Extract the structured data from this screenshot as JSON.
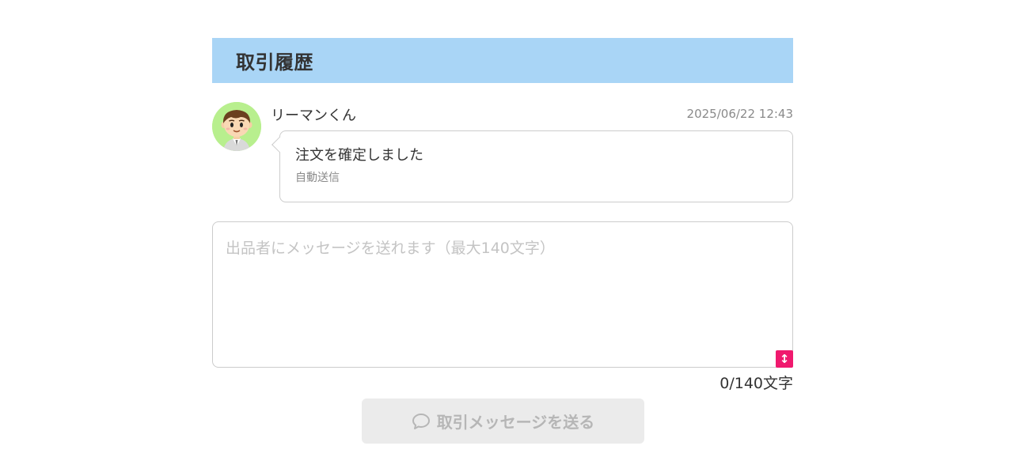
{
  "section": {
    "title": "取引履歴"
  },
  "message": {
    "sender": "リーマンくん",
    "timestamp": "2025/06/22 12:43",
    "text": "注文を確定しました",
    "sub": "自動送信",
    "avatar_icon": "businessman-avatar-icon"
  },
  "input": {
    "placeholder": "出品者にメッセージを送れます（最大140文字）",
    "value": "",
    "resize_icon": "vertical-resize-icon"
  },
  "counter": {
    "text": "0/140文字"
  },
  "send_button": {
    "label": "取引メッセージを送る",
    "icon": "chat-bubble-icon",
    "enabled": false
  },
  "colors": {
    "header_bg": "#a9d5f6",
    "avatar_bg": "#b8ef8e",
    "resize_handle": "#f0196e",
    "button_disabled_bg": "#ebebeb",
    "button_disabled_text": "#b6b6b6"
  }
}
